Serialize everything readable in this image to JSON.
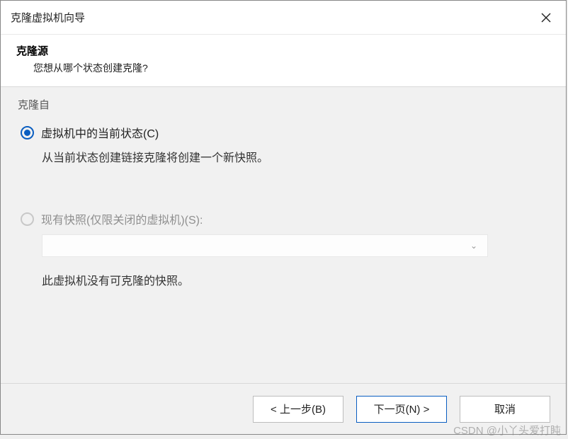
{
  "titlebar": {
    "title": "克隆虚拟机向导"
  },
  "header": {
    "heading": "克隆源",
    "subheading": "您想从哪个状态创建克隆?"
  },
  "group": {
    "legend": "克隆自",
    "option1": {
      "label": "虚拟机中的当前状态(C)",
      "desc": "从当前状态创建链接克隆将创建一个新快照。"
    },
    "option2": {
      "label": "现有快照(仅限关闭的虚拟机)(S):",
      "note": "此虚拟机没有可克隆的快照。"
    }
  },
  "footer": {
    "back": "< 上一步(B)",
    "next": "下一页(N) >",
    "cancel": "取消"
  },
  "watermark": "CSDN @小丫头爱打盹"
}
